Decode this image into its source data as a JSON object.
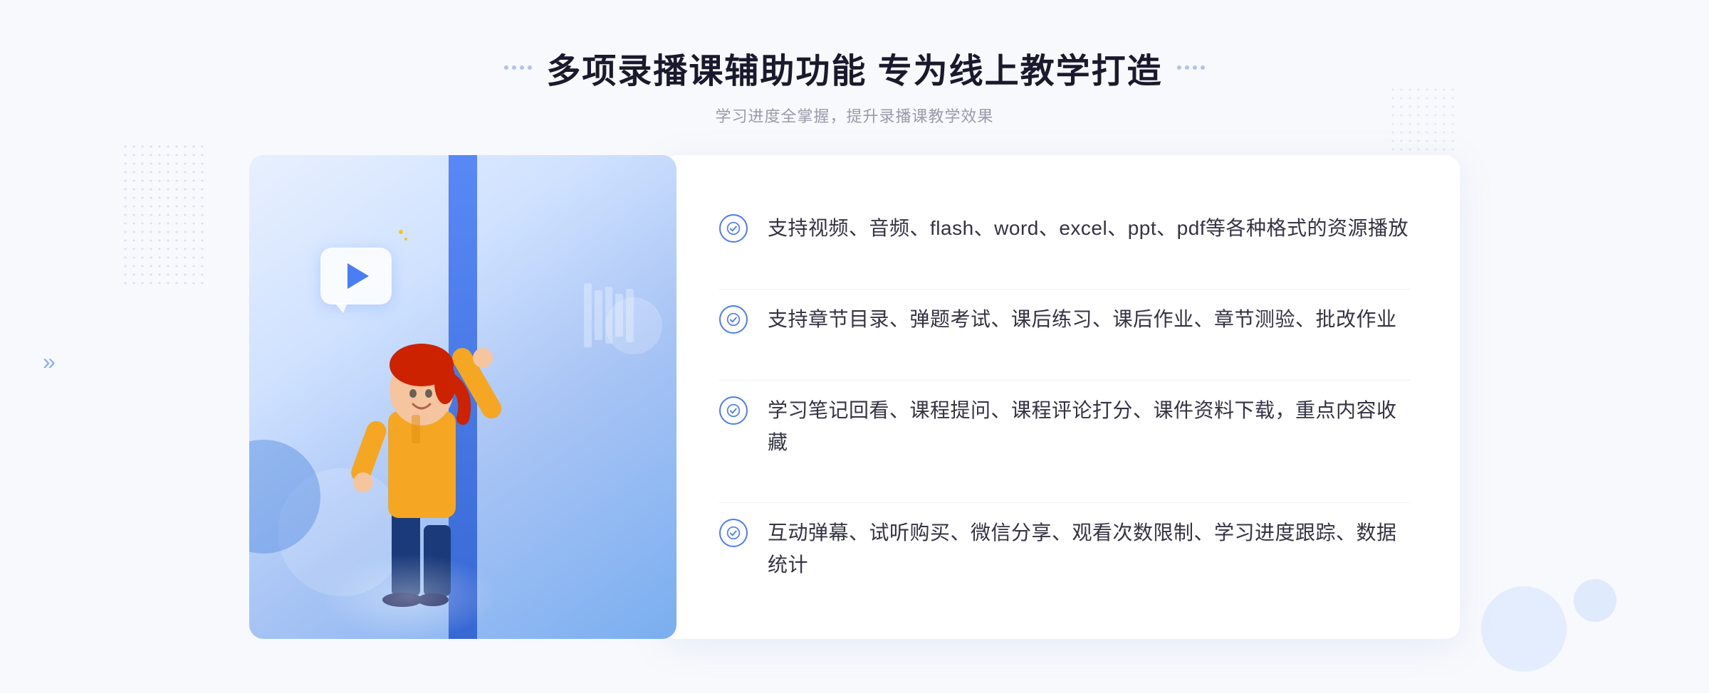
{
  "page": {
    "title": "多项录播课辅助功能 专为线上教学打造",
    "subtitle": "学习进度全掌握，提升录播课教学效果",
    "title_prefix_dots": "decorative",
    "title_suffix_dots": "decorative"
  },
  "features": [
    {
      "id": "feature-1",
      "text": "支持视频、音频、flash、word、excel、ppt、pdf等各种格式的资源播放"
    },
    {
      "id": "feature-2",
      "text": "支持章节目录、弹题考试、课后练习、课后作业、章节测验、批改作业"
    },
    {
      "id": "feature-3",
      "text": "学习笔记回看、课程提问、课程评论打分、课件资料下载，重点内容收藏"
    },
    {
      "id": "feature-4",
      "text": "互动弹幕、试听购买、微信分享、观看次数限制、学习进度跟踪、数据统计"
    }
  ],
  "illustration": {
    "play_button_alt": "播放按钮"
  },
  "arrows": {
    "left_arrow": "»"
  }
}
